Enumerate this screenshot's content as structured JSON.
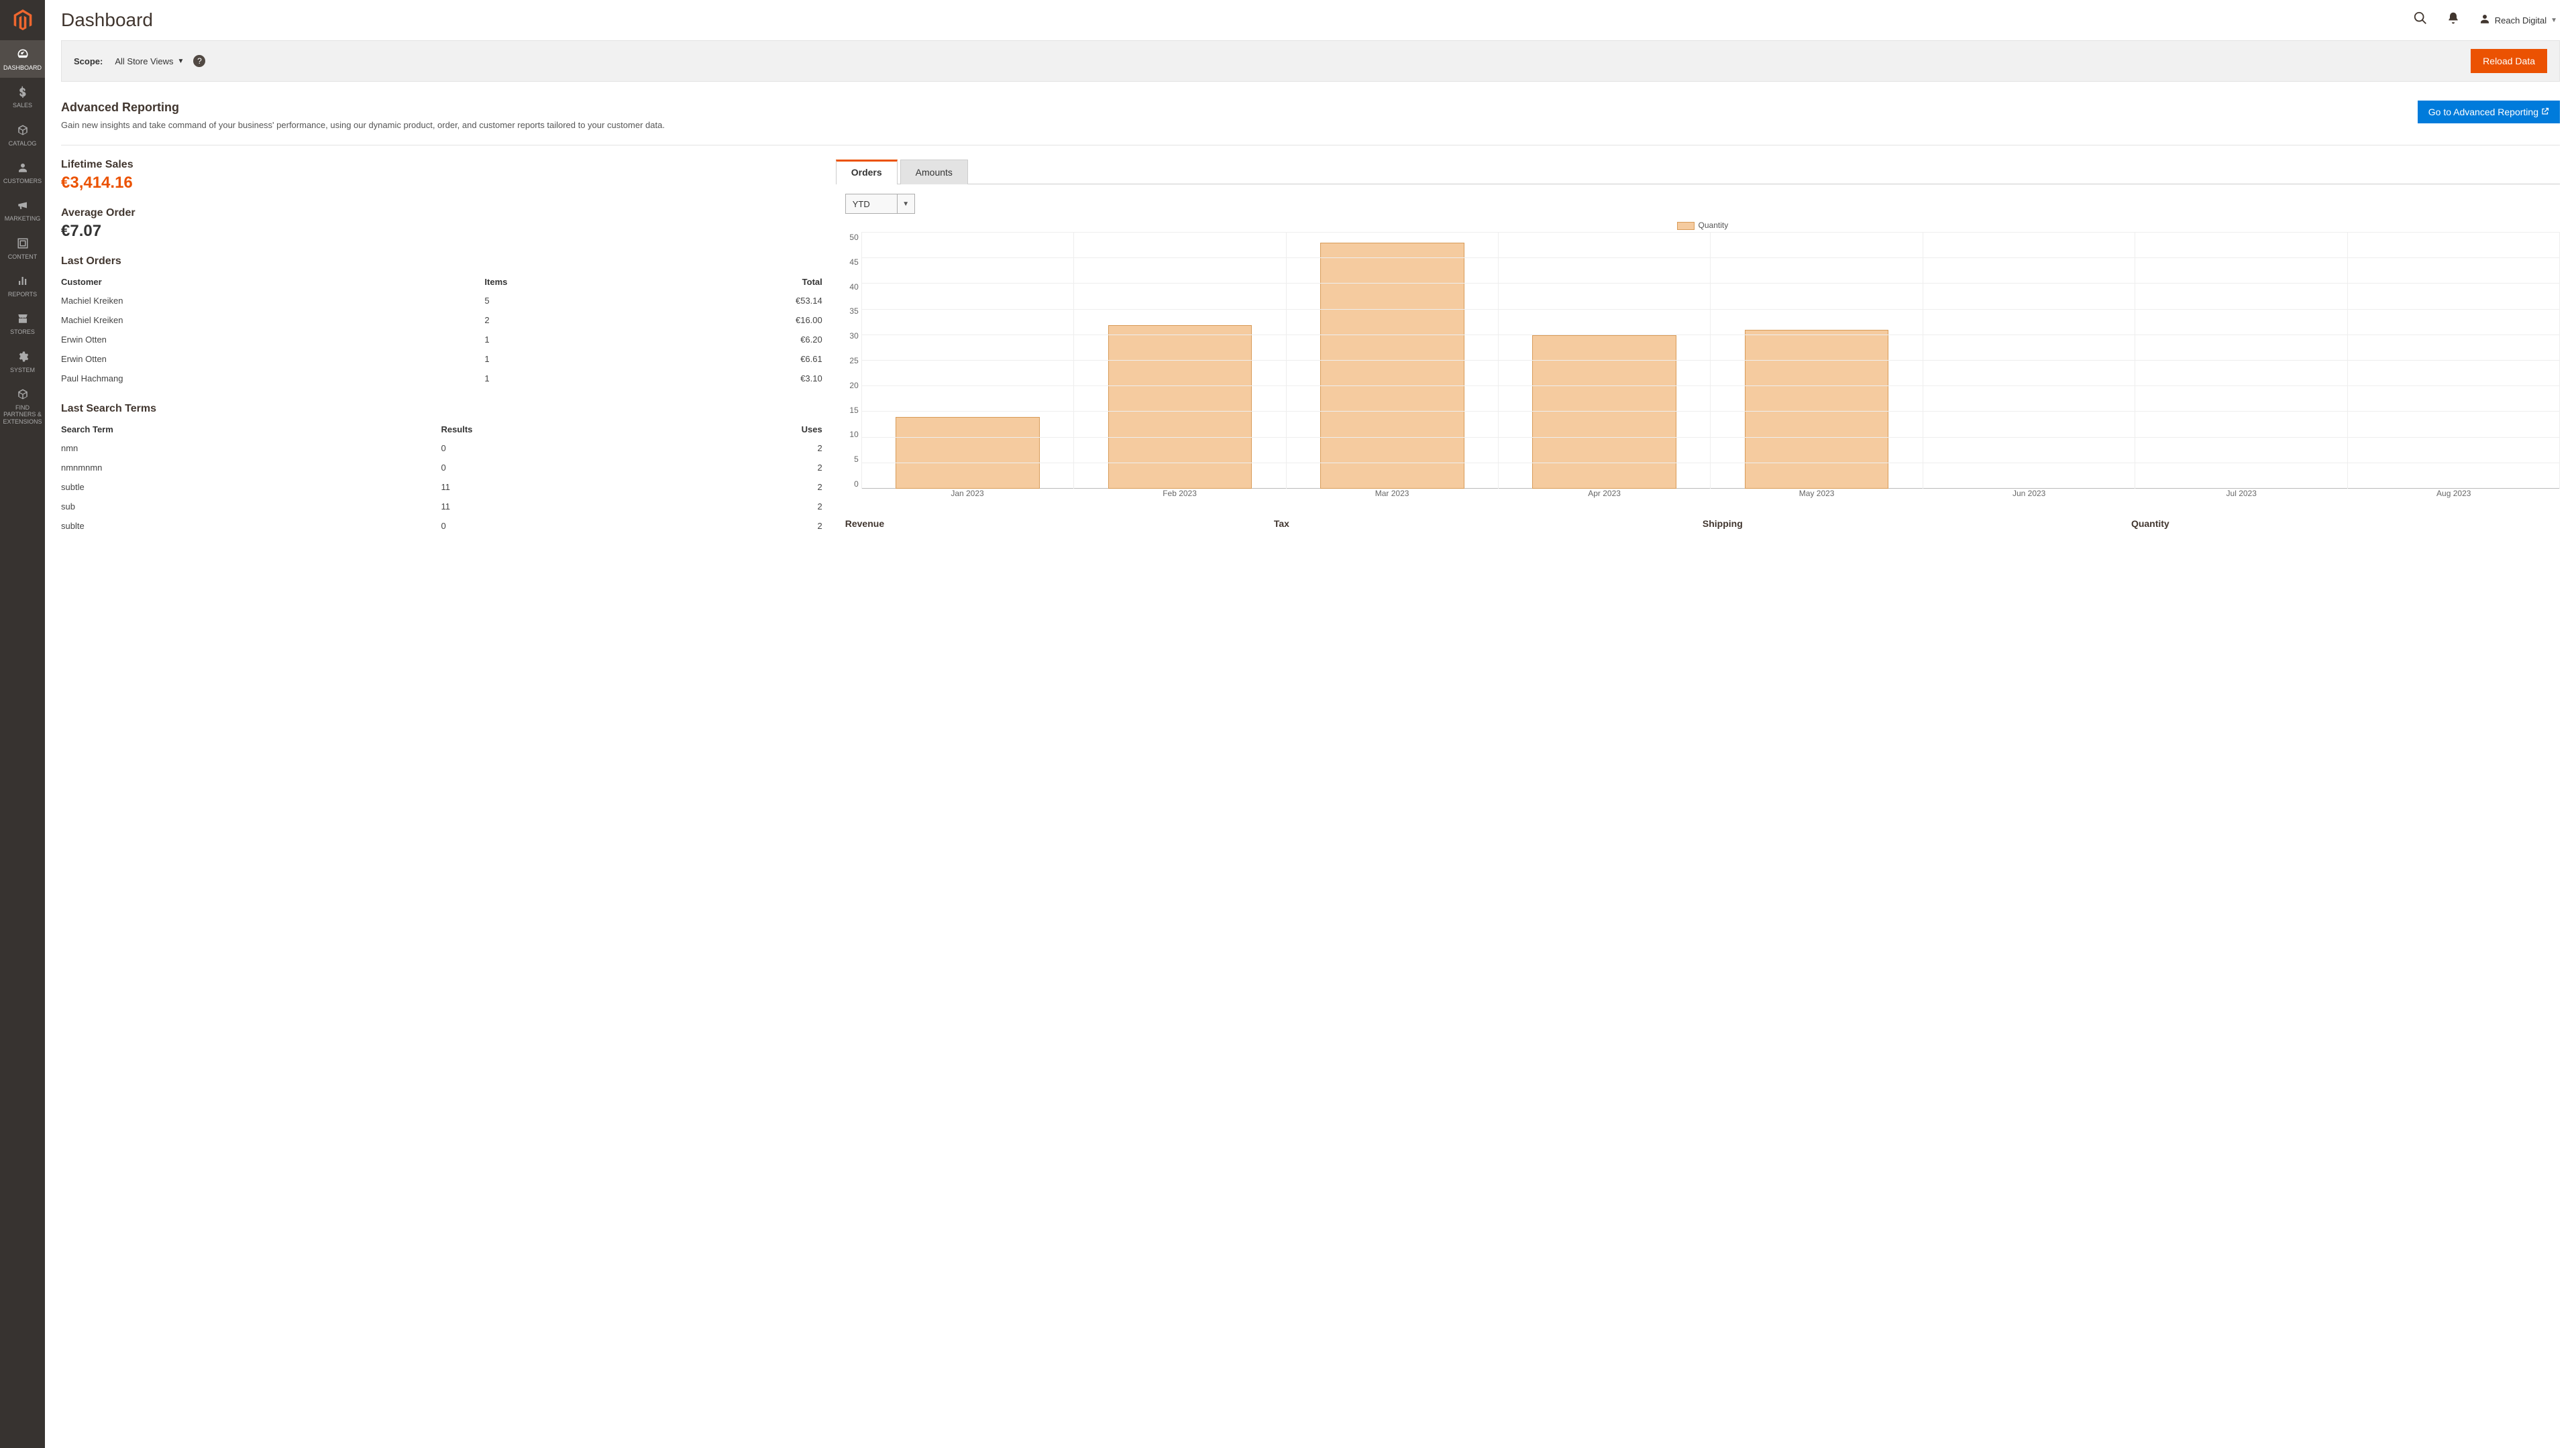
{
  "sidebar": {
    "items": [
      {
        "label": "DASHBOARD"
      },
      {
        "label": "SALES"
      },
      {
        "label": "CATALOG"
      },
      {
        "label": "CUSTOMERS"
      },
      {
        "label": "MARKETING"
      },
      {
        "label": "CONTENT"
      },
      {
        "label": "REPORTS"
      },
      {
        "label": "STORES"
      },
      {
        "label": "SYSTEM"
      },
      {
        "label": "FIND PARTNERS & EXTENSIONS"
      }
    ]
  },
  "header": {
    "title": "Dashboard",
    "user": "Reach Digital"
  },
  "scope": {
    "label": "Scope:",
    "value": "All Store Views",
    "reload_btn": "Reload Data"
  },
  "adv_reporting": {
    "title": "Advanced Reporting",
    "desc": "Gain new insights and take command of your business' performance, using our dynamic product, order, and customer reports tailored to your customer data.",
    "button": "Go to Advanced Reporting"
  },
  "metrics": {
    "lifetime_label": "Lifetime Sales",
    "lifetime_value": "€3,414.16",
    "avg_label": "Average Order",
    "avg_value": "€7.07"
  },
  "last_orders": {
    "title": "Last Orders",
    "cols": {
      "customer": "Customer",
      "items": "Items",
      "total": "Total"
    },
    "rows": [
      {
        "customer": "Machiel Kreiken",
        "items": "5",
        "total": "€53.14"
      },
      {
        "customer": "Machiel Kreiken",
        "items": "2",
        "total": "€16.00"
      },
      {
        "customer": "Erwin Otten",
        "items": "1",
        "total": "€6.20"
      },
      {
        "customer": "Erwin Otten",
        "items": "1",
        "total": "€6.61"
      },
      {
        "customer": "Paul Hachmang",
        "items": "1",
        "total": "€3.10"
      }
    ]
  },
  "last_search": {
    "title": "Last Search Terms",
    "cols": {
      "term": "Search Term",
      "results": "Results",
      "uses": "Uses"
    },
    "rows": [
      {
        "term": "nmn",
        "results": "0",
        "uses": "2"
      },
      {
        "term": "nmnmnmn",
        "results": "0",
        "uses": "2"
      },
      {
        "term": "subtle",
        "results": "11",
        "uses": "2"
      },
      {
        "term": "sub",
        "results": "11",
        "uses": "2"
      },
      {
        "term": "sublte",
        "results": "0",
        "uses": "2"
      }
    ]
  },
  "tabs": {
    "orders": "Orders",
    "amounts": "Amounts"
  },
  "range_selector": "YTD",
  "legend": "Quantity",
  "totals": {
    "revenue": "Revenue",
    "tax": "Tax",
    "shipping": "Shipping",
    "quantity": "Quantity"
  },
  "chart_data": {
    "type": "bar",
    "categories": [
      "Jan 2023",
      "Feb 2023",
      "Mar 2023",
      "Apr 2023",
      "May 2023",
      "Jun 2023",
      "Jul 2023",
      "Aug 2023"
    ],
    "values": [
      14,
      32,
      48,
      30,
      31,
      0,
      0,
      0
    ],
    "ylabel": "",
    "ylim": [
      0,
      50
    ],
    "yticks": [
      0,
      5,
      10,
      15,
      20,
      25,
      30,
      35,
      40,
      45,
      50
    ],
    "series_name": "Quantity"
  }
}
